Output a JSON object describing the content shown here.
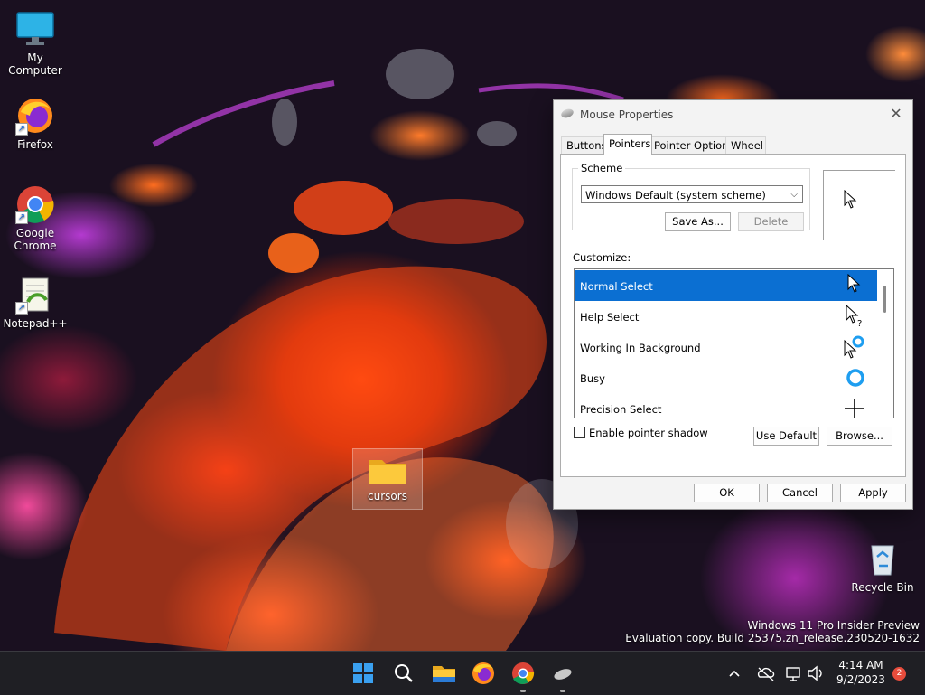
{
  "desktop": {
    "icons": [
      {
        "label": "My Computer"
      },
      {
        "label": "Firefox"
      },
      {
        "label": "Google Chrome"
      },
      {
        "label": "Notepad++"
      },
      {
        "label": "cursors"
      },
      {
        "label": "Recycle Bin"
      }
    ],
    "watermark": {
      "line1": "Windows 11 Pro Insider Preview",
      "line2": "Evaluation copy. Build 25375.zn_release.230520-1632"
    }
  },
  "dialog": {
    "title": "Mouse Properties",
    "close_glyph": "✕",
    "tabs": [
      {
        "label": "Buttons"
      },
      {
        "label": "Pointers",
        "active": true
      },
      {
        "label": "Pointer Options"
      },
      {
        "label": "Wheel"
      }
    ],
    "scheme": {
      "legend": "Scheme",
      "selected": "Windows Default (system scheme)",
      "save_as": "Save As...",
      "delete": "Delete"
    },
    "customize_label": "Customize:",
    "pointers": [
      {
        "label": "Normal Select",
        "icon": "arrow-cursor-icon",
        "selected": true
      },
      {
        "label": "Help Select",
        "icon": "help-cursor-icon"
      },
      {
        "label": "Working In Background",
        "icon": "working-cursor-icon"
      },
      {
        "label": "Busy",
        "icon": "busy-cursor-icon"
      },
      {
        "label": "Precision Select",
        "icon": "crosshair-cursor-icon"
      }
    ],
    "shadow_label": "Enable pointer shadow",
    "use_default": "Use Default",
    "browse": "Browse...",
    "ok": "OK",
    "cancel": "Cancel",
    "apply": "Apply"
  },
  "taskbar": {
    "time": "4:14 AM",
    "date": "9/2/2023",
    "notification_count": "2",
    "colors": {
      "accent": "#0b6fd2",
      "notification": "#e74c3c"
    }
  }
}
